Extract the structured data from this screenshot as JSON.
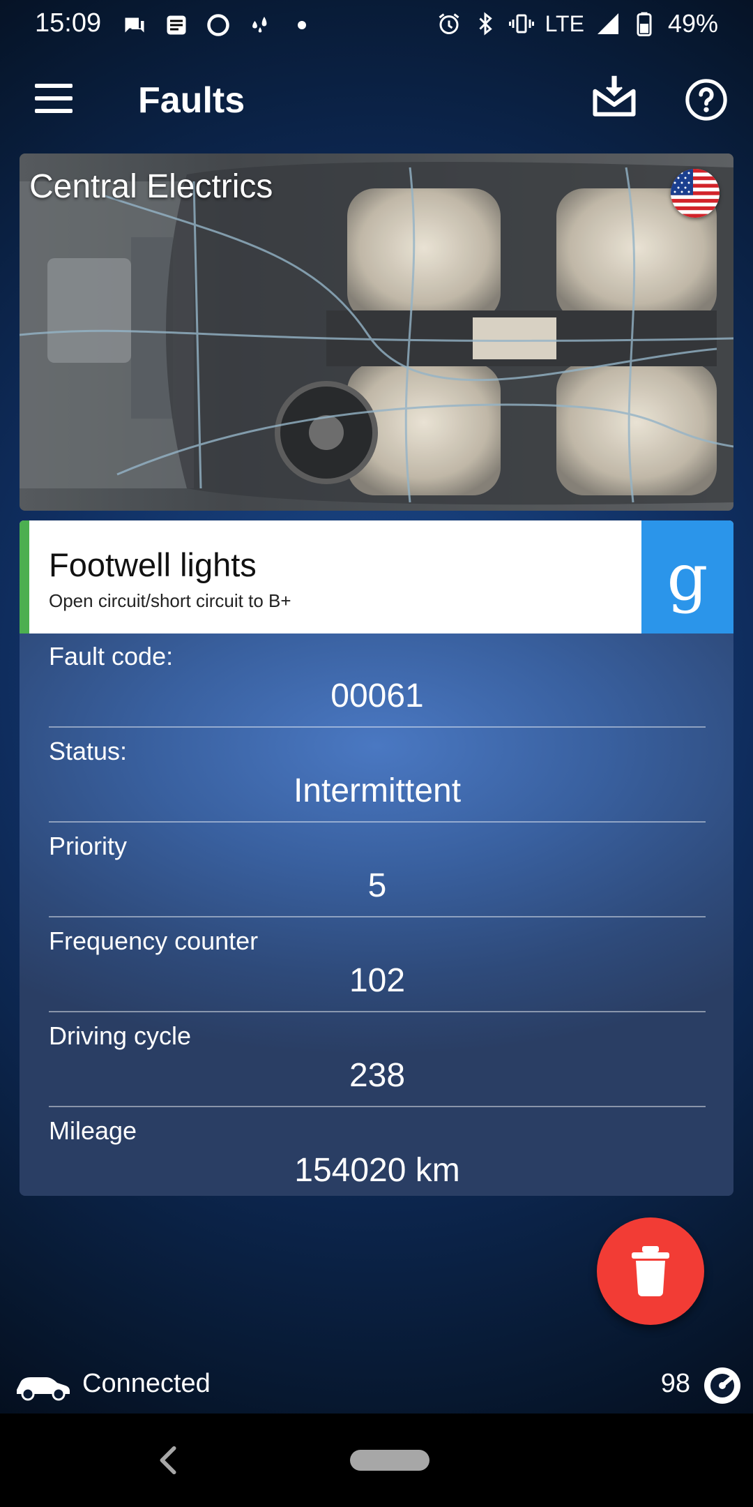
{
  "status_bar": {
    "time": "15:09",
    "network": "LTE",
    "battery": "49%",
    "icons": [
      "chat-icon",
      "message-icon",
      "circle-icon",
      "drops-icon",
      "dot-icon",
      "alarm-icon",
      "bluetooth-icon",
      "vibrate-icon",
      "signal-icon",
      "battery-icon"
    ]
  },
  "toolbar": {
    "title": "Faults",
    "icons": [
      "menu-icon",
      "download-mail-icon",
      "help-icon"
    ]
  },
  "module": {
    "title": "Central Electrics",
    "language_flag": "us-flag-icon"
  },
  "fault": {
    "name": "Footwell lights",
    "description": "Open circuit/short circuit to B+",
    "accent_color": "#4caf50",
    "search_button_glyph": "g",
    "details": [
      {
        "label": "Fault code:",
        "value": "00061"
      },
      {
        "label": "Status:",
        "value": "Intermittent"
      },
      {
        "label": "Priority",
        "value": "5"
      },
      {
        "label": "Frequency counter",
        "value": "102"
      },
      {
        "label": "Driving cycle",
        "value": "238"
      },
      {
        "label": "Mileage",
        "value": "154020 km"
      }
    ]
  },
  "fab": {
    "icon": "trash-icon",
    "color": "#f23c35"
  },
  "connection": {
    "label": "Connected",
    "count": "98",
    "icons": [
      "car-icon",
      "speedometer-icon"
    ]
  },
  "nav": {
    "icons": [
      "back-icon",
      "home-pill"
    ]
  }
}
